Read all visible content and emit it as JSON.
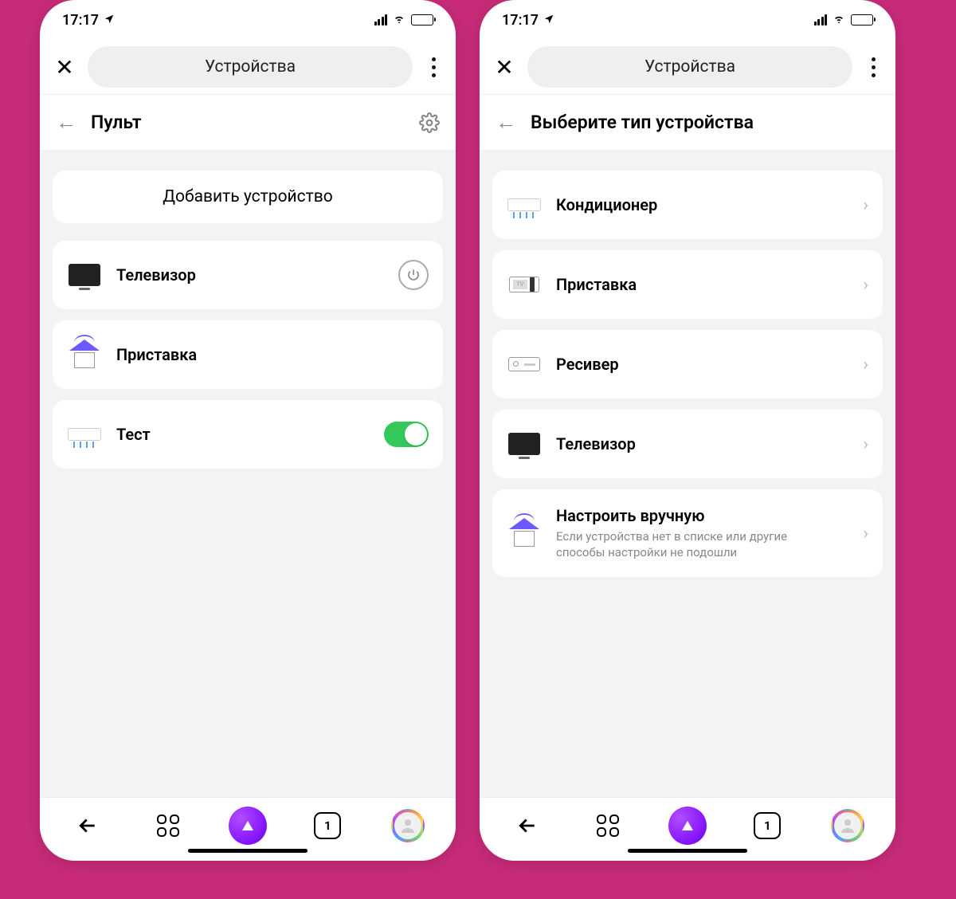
{
  "status": {
    "time": "17:17"
  },
  "left": {
    "topbar_title": "Устройства",
    "subheader_title": "Пульт",
    "add_device_label": "Добавить устройство",
    "devices": [
      {
        "label": "Телевизор"
      },
      {
        "label": "Приставка"
      },
      {
        "label": "Тест"
      }
    ]
  },
  "right": {
    "topbar_title": "Устройства",
    "subheader_title": "Выберите тип устройства",
    "types": [
      {
        "label": "Кондиционер"
      },
      {
        "label": "Приставка"
      },
      {
        "label": "Ресивер"
      },
      {
        "label": "Телевизор"
      }
    ],
    "manual": {
      "title": "Настроить вручную",
      "sub": "Если устройства нет в списке или другие способы настройки не подошли"
    }
  },
  "nav": {
    "tab_count": "1"
  }
}
